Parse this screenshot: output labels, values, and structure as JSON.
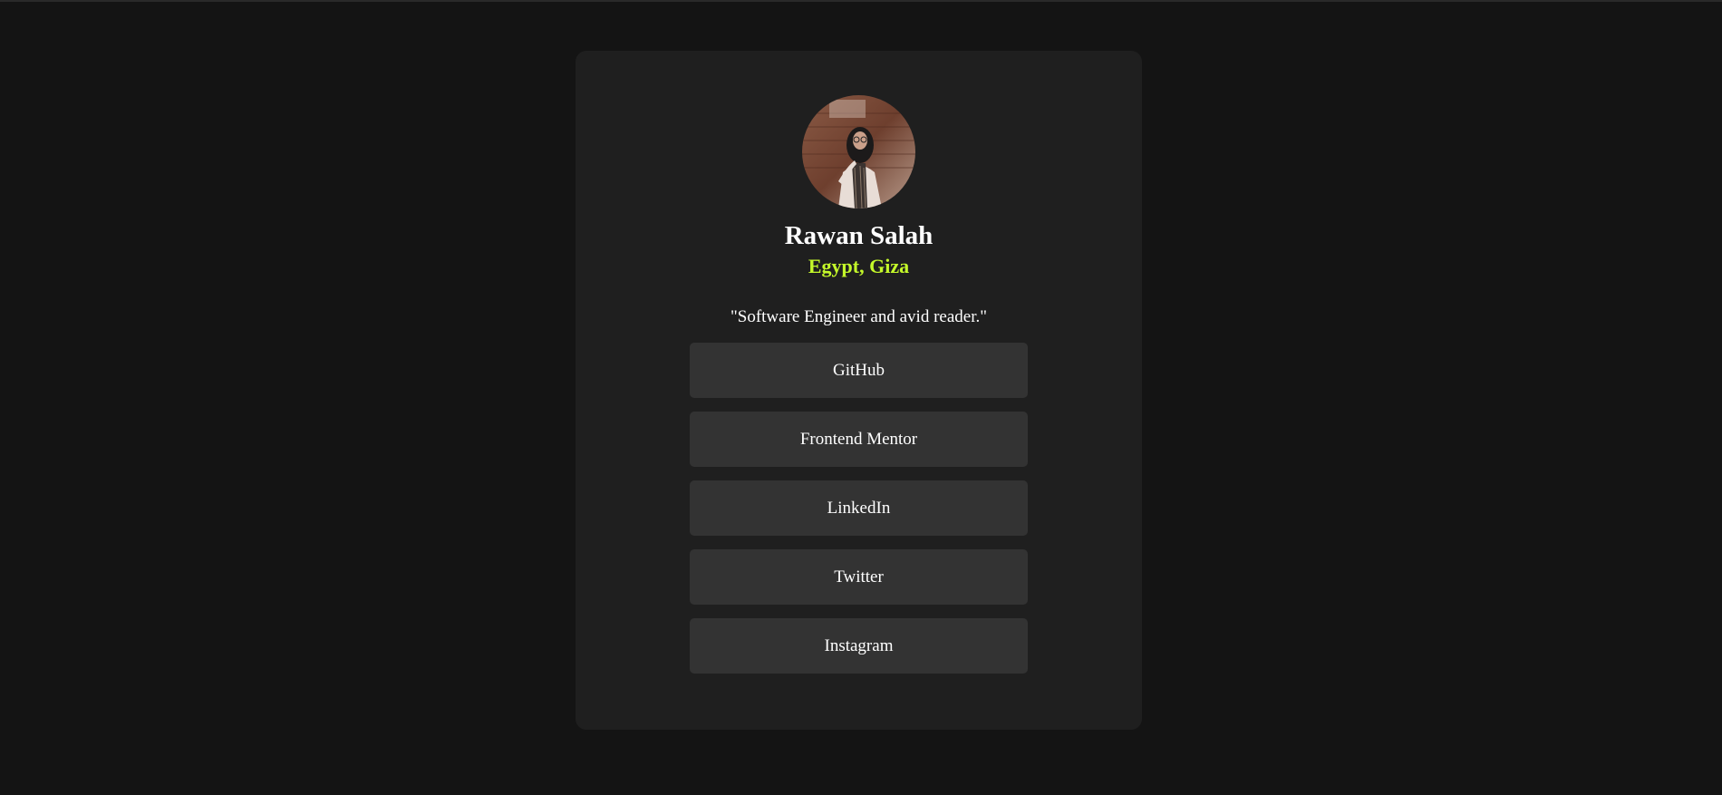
{
  "profile": {
    "name": "Rawan Salah",
    "location": "Egypt, Giza",
    "bio": "\"Software Engineer and avid reader.\"",
    "avatar_icon": "profile-photo"
  },
  "links": [
    {
      "label": "GitHub"
    },
    {
      "label": "Frontend Mentor"
    },
    {
      "label": "LinkedIn"
    },
    {
      "label": "Twitter"
    },
    {
      "label": "Instagram"
    }
  ],
  "colors": {
    "page_background": "#141414",
    "card_background": "#1f1f1f",
    "button_background": "#333333",
    "accent": "#c4f82a",
    "text": "#ffffff"
  }
}
